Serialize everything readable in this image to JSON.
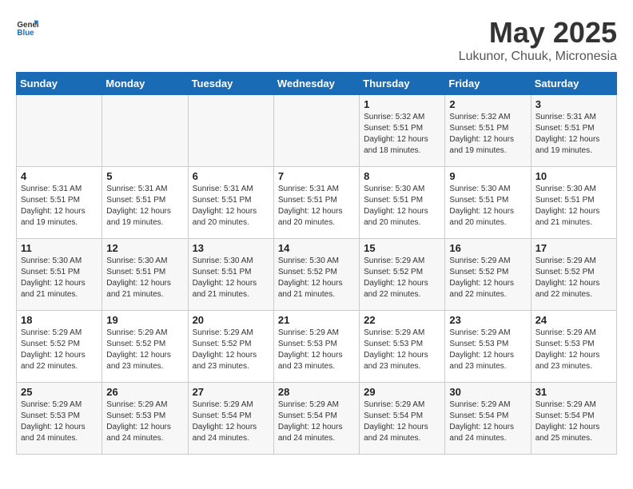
{
  "header": {
    "logo_general": "General",
    "logo_blue": "Blue",
    "title": "May 2025",
    "subtitle": "Lukunor, Chuuk, Micronesia"
  },
  "days_of_week": [
    "Sunday",
    "Monday",
    "Tuesday",
    "Wednesday",
    "Thursday",
    "Friday",
    "Saturday"
  ],
  "weeks": [
    [
      {
        "day": "",
        "sunrise": "",
        "sunset": "",
        "daylight": ""
      },
      {
        "day": "",
        "sunrise": "",
        "sunset": "",
        "daylight": ""
      },
      {
        "day": "",
        "sunrise": "",
        "sunset": "",
        "daylight": ""
      },
      {
        "day": "",
        "sunrise": "",
        "sunset": "",
        "daylight": ""
      },
      {
        "day": "1",
        "sunrise": "5:32 AM",
        "sunset": "5:51 PM",
        "daylight": "12 hours and 18 minutes."
      },
      {
        "day": "2",
        "sunrise": "5:32 AM",
        "sunset": "5:51 PM",
        "daylight": "12 hours and 19 minutes."
      },
      {
        "day": "3",
        "sunrise": "5:31 AM",
        "sunset": "5:51 PM",
        "daylight": "12 hours and 19 minutes."
      }
    ],
    [
      {
        "day": "4",
        "sunrise": "5:31 AM",
        "sunset": "5:51 PM",
        "daylight": "12 hours and 19 minutes."
      },
      {
        "day": "5",
        "sunrise": "5:31 AM",
        "sunset": "5:51 PM",
        "daylight": "12 hours and 19 minutes."
      },
      {
        "day": "6",
        "sunrise": "5:31 AM",
        "sunset": "5:51 PM",
        "daylight": "12 hours and 20 minutes."
      },
      {
        "day": "7",
        "sunrise": "5:31 AM",
        "sunset": "5:51 PM",
        "daylight": "12 hours and 20 minutes."
      },
      {
        "day": "8",
        "sunrise": "5:30 AM",
        "sunset": "5:51 PM",
        "daylight": "12 hours and 20 minutes."
      },
      {
        "day": "9",
        "sunrise": "5:30 AM",
        "sunset": "5:51 PM",
        "daylight": "12 hours and 20 minutes."
      },
      {
        "day": "10",
        "sunrise": "5:30 AM",
        "sunset": "5:51 PM",
        "daylight": "12 hours and 21 minutes."
      }
    ],
    [
      {
        "day": "11",
        "sunrise": "5:30 AM",
        "sunset": "5:51 PM",
        "daylight": "12 hours and 21 minutes."
      },
      {
        "day": "12",
        "sunrise": "5:30 AM",
        "sunset": "5:51 PM",
        "daylight": "12 hours and 21 minutes."
      },
      {
        "day": "13",
        "sunrise": "5:30 AM",
        "sunset": "5:51 PM",
        "daylight": "12 hours and 21 minutes."
      },
      {
        "day": "14",
        "sunrise": "5:30 AM",
        "sunset": "5:52 PM",
        "daylight": "12 hours and 21 minutes."
      },
      {
        "day": "15",
        "sunrise": "5:29 AM",
        "sunset": "5:52 PM",
        "daylight": "12 hours and 22 minutes."
      },
      {
        "day": "16",
        "sunrise": "5:29 AM",
        "sunset": "5:52 PM",
        "daylight": "12 hours and 22 minutes."
      },
      {
        "day": "17",
        "sunrise": "5:29 AM",
        "sunset": "5:52 PM",
        "daylight": "12 hours and 22 minutes."
      }
    ],
    [
      {
        "day": "18",
        "sunrise": "5:29 AM",
        "sunset": "5:52 PM",
        "daylight": "12 hours and 22 minutes."
      },
      {
        "day": "19",
        "sunrise": "5:29 AM",
        "sunset": "5:52 PM",
        "daylight": "12 hours and 23 minutes."
      },
      {
        "day": "20",
        "sunrise": "5:29 AM",
        "sunset": "5:52 PM",
        "daylight": "12 hours and 23 minutes."
      },
      {
        "day": "21",
        "sunrise": "5:29 AM",
        "sunset": "5:53 PM",
        "daylight": "12 hours and 23 minutes."
      },
      {
        "day": "22",
        "sunrise": "5:29 AM",
        "sunset": "5:53 PM",
        "daylight": "12 hours and 23 minutes."
      },
      {
        "day": "23",
        "sunrise": "5:29 AM",
        "sunset": "5:53 PM",
        "daylight": "12 hours and 23 minutes."
      },
      {
        "day": "24",
        "sunrise": "5:29 AM",
        "sunset": "5:53 PM",
        "daylight": "12 hours and 23 minutes."
      }
    ],
    [
      {
        "day": "25",
        "sunrise": "5:29 AM",
        "sunset": "5:53 PM",
        "daylight": "12 hours and 24 minutes."
      },
      {
        "day": "26",
        "sunrise": "5:29 AM",
        "sunset": "5:53 PM",
        "daylight": "12 hours and 24 minutes."
      },
      {
        "day": "27",
        "sunrise": "5:29 AM",
        "sunset": "5:54 PM",
        "daylight": "12 hours and 24 minutes."
      },
      {
        "day": "28",
        "sunrise": "5:29 AM",
        "sunset": "5:54 PM",
        "daylight": "12 hours and 24 minutes."
      },
      {
        "day": "29",
        "sunrise": "5:29 AM",
        "sunset": "5:54 PM",
        "daylight": "12 hours and 24 minutes."
      },
      {
        "day": "30",
        "sunrise": "5:29 AM",
        "sunset": "5:54 PM",
        "daylight": "12 hours and 24 minutes."
      },
      {
        "day": "31",
        "sunrise": "5:29 AM",
        "sunset": "5:54 PM",
        "daylight": "12 hours and 25 minutes."
      }
    ]
  ],
  "labels": {
    "sunrise": "Sunrise:",
    "sunset": "Sunset:",
    "daylight": "Daylight:"
  }
}
